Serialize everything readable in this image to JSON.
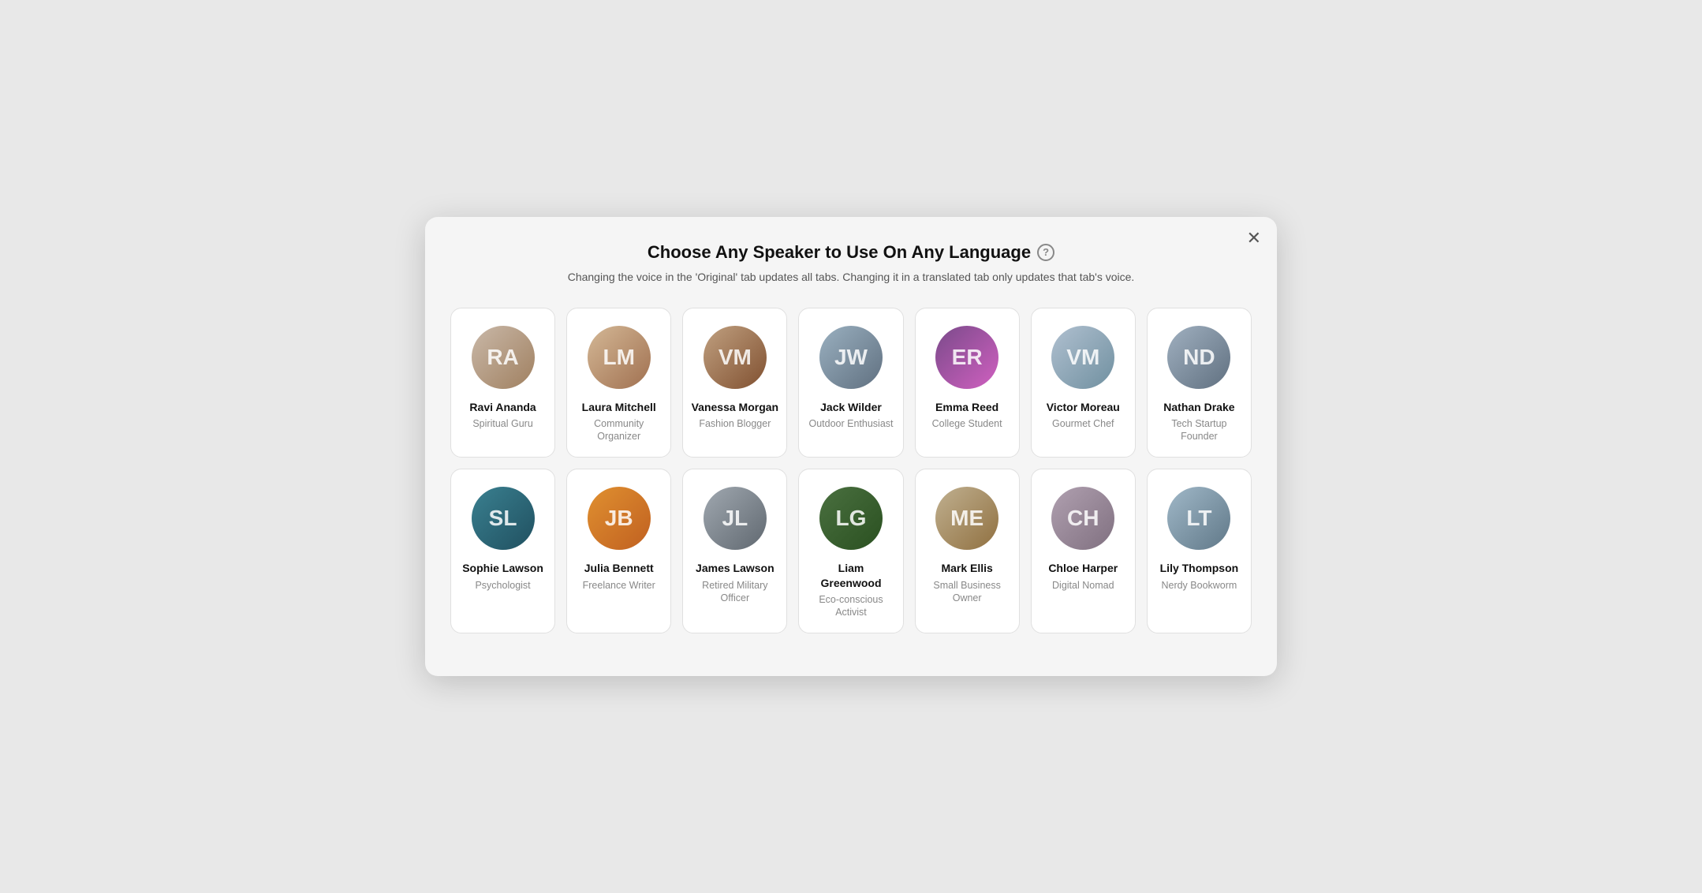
{
  "modal": {
    "title": "Choose Any Speaker to Use On Any Language",
    "subtitle": "Changing the voice in the 'Original' tab updates all tabs. Changing it in a translated tab only updates that tab's voice.",
    "close_label": "✕",
    "help_label": "?",
    "rows": [
      [
        {
          "id": "ravi",
          "name": "Ravi Ananda",
          "role": "Spiritual Guru",
          "avatar_class": "av-ravi",
          "initials": "RA"
        },
        {
          "id": "laura",
          "name": "Laura Mitchell",
          "role": "Community Organizer",
          "avatar_class": "av-laura",
          "initials": "LM"
        },
        {
          "id": "vanessa",
          "name": "Vanessa Morgan",
          "role": "Fashion Blogger",
          "avatar_class": "av-vanessa",
          "initials": "VM"
        },
        {
          "id": "jack",
          "name": "Jack Wilder",
          "role": "Outdoor Enthusiast",
          "avatar_class": "av-jack",
          "initials": "JW"
        },
        {
          "id": "emma",
          "name": "Emma Reed",
          "role": "College Student",
          "avatar_class": "av-emma",
          "initials": "ER"
        },
        {
          "id": "victor",
          "name": "Victor Moreau",
          "role": "Gourmet Chef",
          "avatar_class": "av-victor",
          "initials": "VM"
        },
        {
          "id": "nathan",
          "name": "Nathan Drake",
          "role": "Tech Startup Founder",
          "avatar_class": "av-nathan",
          "initials": "ND"
        }
      ],
      [
        {
          "id": "sophie",
          "name": "Sophie Lawson",
          "role": "Psychologist",
          "avatar_class": "av-sophie",
          "initials": "SL"
        },
        {
          "id": "julia",
          "name": "Julia Bennett",
          "role": "Freelance Writer",
          "avatar_class": "av-julia",
          "initials": "JB"
        },
        {
          "id": "james",
          "name": "James Lawson",
          "role": "Retired Military Officer",
          "avatar_class": "av-james",
          "initials": "JL"
        },
        {
          "id": "liam",
          "name": "Liam Greenwood",
          "role": "Eco-conscious Activist",
          "avatar_class": "av-liam",
          "initials": "LG"
        },
        {
          "id": "mark",
          "name": "Mark Ellis",
          "role": "Small Business Owner",
          "avatar_class": "av-mark",
          "initials": "ME"
        },
        {
          "id": "chloe",
          "name": "Chloe Harper",
          "role": "Digital Nomad",
          "avatar_class": "av-chloe",
          "initials": "CH"
        },
        {
          "id": "lily",
          "name": "Lily Thompson",
          "role": "Nerdy Bookworm",
          "avatar_class": "av-lily",
          "initials": "LT"
        }
      ]
    ]
  }
}
